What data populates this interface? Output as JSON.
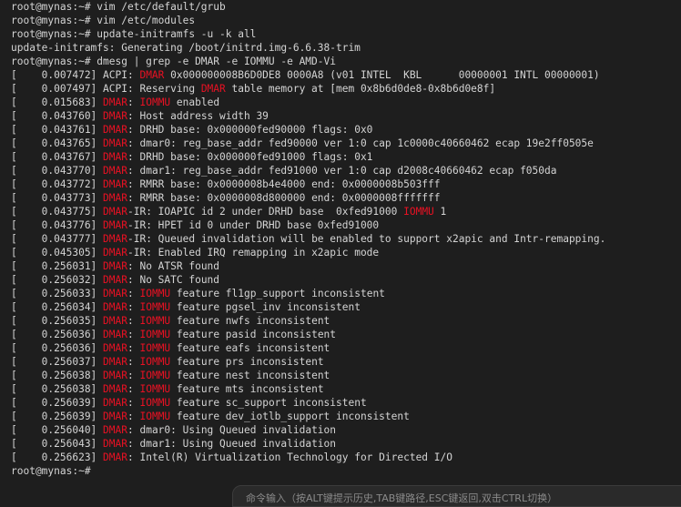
{
  "terminal": {
    "colors": {
      "background": "#1e1e1e",
      "foreground": "#d4d4d4",
      "highlight": "#e81123"
    },
    "lines": [
      [
        {
          "t": "root@mynas:~# vim /etc/default/grub"
        }
      ],
      [
        {
          "t": "root@mynas:~# vim /etc/modules"
        }
      ],
      [
        {
          "t": "root@mynas:~# update-initramfs -u -k all"
        }
      ],
      [
        {
          "t": "update-initramfs: Generating /boot/initrd.img-6.6.38-trim"
        }
      ],
      [
        {
          "t": "root@mynas:~# dmesg | grep -e DMAR -e IOMMU -e AMD-Vi"
        }
      ],
      [
        {
          "t": "[    0.007472] ACPI: "
        },
        {
          "t": "DMAR",
          "hl": true
        },
        {
          "t": " 0x000000008B6D0DE8 0000A8 (v01 INTEL  KBL      00000001 INTL 00000001)"
        }
      ],
      [
        {
          "t": "[    0.007497] ACPI: Reserving "
        },
        {
          "t": "DMAR",
          "hl": true
        },
        {
          "t": " table memory at [mem 0x8b6d0de8-0x8b6d0e8f]"
        }
      ],
      [
        {
          "t": "[    0.015683] "
        },
        {
          "t": "DMAR",
          "hl": true
        },
        {
          "t": ": "
        },
        {
          "t": "IOMMU",
          "hl": true
        },
        {
          "t": " enabled"
        }
      ],
      [
        {
          "t": "[    0.043760] "
        },
        {
          "t": "DMAR",
          "hl": true
        },
        {
          "t": ": Host address width 39"
        }
      ],
      [
        {
          "t": "[    0.043761] "
        },
        {
          "t": "DMAR",
          "hl": true
        },
        {
          "t": ": DRHD base: 0x000000fed90000 flags: 0x0"
        }
      ],
      [
        {
          "t": "[    0.043765] "
        },
        {
          "t": "DMAR",
          "hl": true
        },
        {
          "t": ": dmar0: reg_base_addr fed90000 ver 1:0 cap 1c0000c40660462 ecap 19e2ff0505e"
        }
      ],
      [
        {
          "t": "[    0.043767] "
        },
        {
          "t": "DMAR",
          "hl": true
        },
        {
          "t": ": DRHD base: 0x000000fed91000 flags: 0x1"
        }
      ],
      [
        {
          "t": "[    0.043770] "
        },
        {
          "t": "DMAR",
          "hl": true
        },
        {
          "t": ": dmar1: reg_base_addr fed91000 ver 1:0 cap d2008c40660462 ecap f050da"
        }
      ],
      [
        {
          "t": "[    0.043772] "
        },
        {
          "t": "DMAR",
          "hl": true
        },
        {
          "t": ": RMRR base: 0x0000008b4e4000 end: 0x0000008b503fff"
        }
      ],
      [
        {
          "t": "[    0.043773] "
        },
        {
          "t": "DMAR",
          "hl": true
        },
        {
          "t": ": RMRR base: 0x0000008d800000 end: 0x0000008fffffff"
        }
      ],
      [
        {
          "t": "[    0.043775] "
        },
        {
          "t": "DMAR",
          "hl": true
        },
        {
          "t": "-IR: IOAPIC id 2 under DRHD base  0xfed91000 "
        },
        {
          "t": "IOMMU",
          "hl": true
        },
        {
          "t": " 1"
        }
      ],
      [
        {
          "t": "[    0.043776] "
        },
        {
          "t": "DMAR",
          "hl": true
        },
        {
          "t": "-IR: HPET id 0 under DRHD base 0xfed91000"
        }
      ],
      [
        {
          "t": "[    0.043777] "
        },
        {
          "t": "DMAR",
          "hl": true
        },
        {
          "t": "-IR: Queued invalidation will be enabled to support x2apic and Intr-remapping."
        }
      ],
      [
        {
          "t": "[    0.045305] "
        },
        {
          "t": "DMAR",
          "hl": true
        },
        {
          "t": "-IR: Enabled IRQ remapping in x2apic mode"
        }
      ],
      [
        {
          "t": "[    0.256031] "
        },
        {
          "t": "DMAR",
          "hl": true
        },
        {
          "t": ": No ATSR found"
        }
      ],
      [
        {
          "t": "[    0.256032] "
        },
        {
          "t": "DMAR",
          "hl": true
        },
        {
          "t": ": No SATC found"
        }
      ],
      [
        {
          "t": "[    0.256033] "
        },
        {
          "t": "DMAR",
          "hl": true
        },
        {
          "t": ": "
        },
        {
          "t": "IOMMU",
          "hl": true
        },
        {
          "t": " feature fl1gp_support inconsistent"
        }
      ],
      [
        {
          "t": "[    0.256034] "
        },
        {
          "t": "DMAR",
          "hl": true
        },
        {
          "t": ": "
        },
        {
          "t": "IOMMU",
          "hl": true
        },
        {
          "t": " feature pgsel_inv inconsistent"
        }
      ],
      [
        {
          "t": "[    0.256035] "
        },
        {
          "t": "DMAR",
          "hl": true
        },
        {
          "t": ": "
        },
        {
          "t": "IOMMU",
          "hl": true
        },
        {
          "t": " feature nwfs inconsistent"
        }
      ],
      [
        {
          "t": "[    0.256036] "
        },
        {
          "t": "DMAR",
          "hl": true
        },
        {
          "t": ": "
        },
        {
          "t": "IOMMU",
          "hl": true
        },
        {
          "t": " feature pasid inconsistent"
        }
      ],
      [
        {
          "t": "[    0.256036] "
        },
        {
          "t": "DMAR",
          "hl": true
        },
        {
          "t": ": "
        },
        {
          "t": "IOMMU",
          "hl": true
        },
        {
          "t": " feature eafs inconsistent"
        }
      ],
      [
        {
          "t": "[    0.256037] "
        },
        {
          "t": "DMAR",
          "hl": true
        },
        {
          "t": ": "
        },
        {
          "t": "IOMMU",
          "hl": true
        },
        {
          "t": " feature prs inconsistent"
        }
      ],
      [
        {
          "t": "[    0.256038] "
        },
        {
          "t": "DMAR",
          "hl": true
        },
        {
          "t": ": "
        },
        {
          "t": "IOMMU",
          "hl": true
        },
        {
          "t": " feature nest inconsistent"
        }
      ],
      [
        {
          "t": "[    0.256038] "
        },
        {
          "t": "DMAR",
          "hl": true
        },
        {
          "t": ": "
        },
        {
          "t": "IOMMU",
          "hl": true
        },
        {
          "t": " feature mts inconsistent"
        }
      ],
      [
        {
          "t": "[    0.256039] "
        },
        {
          "t": "DMAR",
          "hl": true
        },
        {
          "t": ": "
        },
        {
          "t": "IOMMU",
          "hl": true
        },
        {
          "t": " feature sc_support inconsistent"
        }
      ],
      [
        {
          "t": "[    0.256039] "
        },
        {
          "t": "DMAR",
          "hl": true
        },
        {
          "t": ": "
        },
        {
          "t": "IOMMU",
          "hl": true
        },
        {
          "t": " feature dev_iotlb_support inconsistent"
        }
      ],
      [
        {
          "t": "[    0.256040] "
        },
        {
          "t": "DMAR",
          "hl": true
        },
        {
          "t": ": dmar0: Using Queued invalidation"
        }
      ],
      [
        {
          "t": "[    0.256043] "
        },
        {
          "t": "DMAR",
          "hl": true
        },
        {
          "t": ": dmar1: Using Queued invalidation"
        }
      ],
      [
        {
          "t": "[    0.256623] "
        },
        {
          "t": "DMAR",
          "hl": true
        },
        {
          "t": ": Intel(R) Virtualization Technology for Directed I/O"
        }
      ],
      [
        {
          "t": "root@mynas:~#"
        }
      ]
    ]
  },
  "hint_bar": {
    "text": "命令输入（按ALT键提示历史,TAB键路径,ESC键返回,双击CTRL切换）"
  }
}
